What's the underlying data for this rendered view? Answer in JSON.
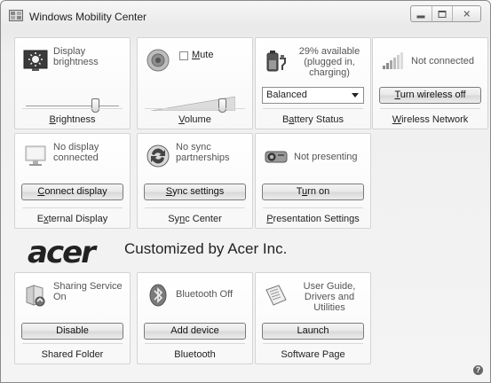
{
  "window": {
    "title": "Windows Mobility Center",
    "icon": "mobility-center-icon"
  },
  "caption_buttons": {
    "minimize_icon": "minimize-icon",
    "maximize_icon": "maximize-icon",
    "close_glyph": "✕"
  },
  "tiles": {
    "brightness": {
      "status": "Display brightness",
      "caption_prefix": "",
      "caption_accel": "B",
      "caption_rest": "rightness",
      "slider_value": 0.75,
      "icon": "brightness-icon"
    },
    "volume": {
      "mute_prefix": "",
      "mute_accel": "M",
      "mute_rest": "ute",
      "mute_checked": false,
      "caption_accel": "V",
      "caption_rest": "olume",
      "slider_value": 0.88,
      "icon": "speaker-icon"
    },
    "battery": {
      "status": "29% available (plugged in, charging)",
      "plan": "Balanced",
      "caption_prefix": "B",
      "caption_accel": "a",
      "caption_rest": "ttery Status",
      "icon": "battery-icon"
    },
    "wireless": {
      "status": "Not connected",
      "button_prefix": "",
      "button_accel": "T",
      "button_rest": "urn wireless off",
      "caption_accel": "W",
      "caption_rest": "ireless Network",
      "icon": "signal-bars-icon"
    },
    "external_display": {
      "status": "No display connected",
      "button_accel": "C",
      "button_rest": "onnect display",
      "caption_prefix": "E",
      "caption_accel": "x",
      "caption_rest": "ternal Display",
      "icon": "monitor-icon"
    },
    "sync_center": {
      "status": "No sync partnerships",
      "button_accel": "S",
      "button_rest": "ync settings",
      "caption_prefix": "Sy",
      "caption_accel": "n",
      "caption_rest": "c Center",
      "icon": "sync-icon"
    },
    "presentation": {
      "status": "Not presenting",
      "button_prefix": "T",
      "button_accel": "u",
      "button_rest": "rn on",
      "caption_accel": "P",
      "caption_rest": "resentation Settings",
      "icon": "projector-icon"
    },
    "shared_folder": {
      "status": "Sharing Service On",
      "button_label": "Disable",
      "caption": "Shared Folder",
      "icon": "shared-folder-icon"
    },
    "bluetooth": {
      "status": "Bluetooth Off",
      "button_label": "Add device",
      "caption": "Bluetooth",
      "icon": "bluetooth-icon"
    },
    "software_page": {
      "status": "User Guide, Drivers and Utilities",
      "button_label": "Launch",
      "caption": "Software Page",
      "icon": "document-icon"
    }
  },
  "brand": {
    "logo_text": "acer",
    "customized_text": "Customized by Acer Inc."
  },
  "help": {
    "glyph": "?",
    "icon": "help-icon"
  }
}
